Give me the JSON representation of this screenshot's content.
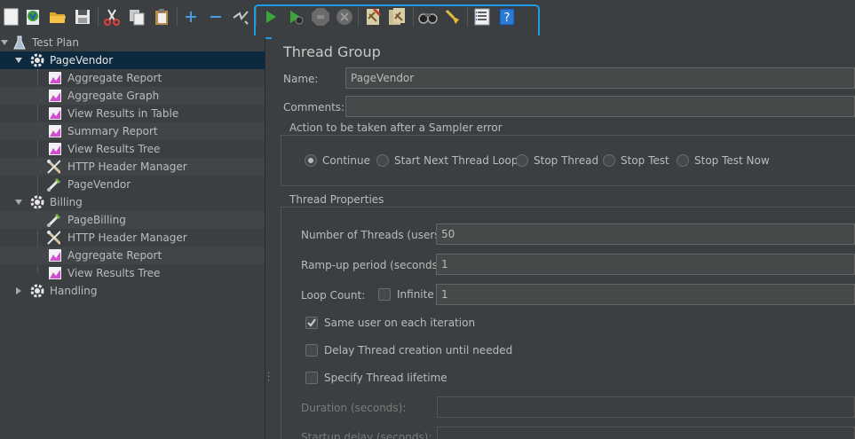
{
  "toolbar": {
    "buttons": [
      {
        "name": "new-icon"
      },
      {
        "name": "templates-icon"
      },
      {
        "name": "open-icon"
      },
      {
        "name": "save-icon"
      },
      {
        "name": "cut-icon"
      },
      {
        "name": "copy-icon"
      },
      {
        "name": "paste-icon"
      },
      {
        "name": "expand-all-icon"
      },
      {
        "name": "collapse-all-icon"
      },
      {
        "name": "toggle-icon"
      },
      {
        "name": "start-icon"
      },
      {
        "name": "start-no-pauses-icon"
      },
      {
        "name": "stop-icon"
      },
      {
        "name": "shutdown-icon"
      },
      {
        "name": "clear-icon"
      },
      {
        "name": "clear-all-icon"
      },
      {
        "name": "search-icon"
      },
      {
        "name": "reset-search-icon"
      },
      {
        "name": "function-helper-icon"
      },
      {
        "name": "help-icon"
      }
    ],
    "highlight_color": "#1e9be6"
  },
  "tree": {
    "items": [
      {
        "label": "Test Plan",
        "icon": "test-plan-icon"
      },
      {
        "label": "PageVendor",
        "icon": "thread-group-icon"
      },
      {
        "label": "Aggregate Report",
        "icon": "listener-icon"
      },
      {
        "label": "Aggregate Graph",
        "icon": "listener-icon"
      },
      {
        "label": "View Results in Table",
        "icon": "listener-icon"
      },
      {
        "label": "Summary Report",
        "icon": "listener-icon"
      },
      {
        "label": "View Results Tree",
        "icon": "listener-icon"
      },
      {
        "label": "HTTP Header Manager",
        "icon": "config-element-icon"
      },
      {
        "label": "PageVendor",
        "icon": "sampler-icon"
      },
      {
        "label": "Billing",
        "icon": "thread-group-icon"
      },
      {
        "label": "PageBilling",
        "icon": "sampler-icon"
      },
      {
        "label": "HTTP Header Manager",
        "icon": "config-element-icon"
      },
      {
        "label": "Aggregate Report",
        "icon": "listener-icon"
      },
      {
        "label": "View Results Tree",
        "icon": "listener-icon"
      },
      {
        "label": "Handling",
        "icon": "thread-group-icon"
      }
    ],
    "selected_color": "#0d293e"
  },
  "panel": {
    "title": "Thread Group",
    "name_label": "Name:",
    "name_value": "PageVendor",
    "comments_label": "Comments:",
    "comments_value": "",
    "error_section": {
      "title": "Action to be taken after a Sampler error",
      "options": [
        "Continue",
        "Start Next Thread Loop",
        "Stop Thread",
        "Stop Test",
        "Stop Test Now"
      ],
      "selected": "Continue"
    },
    "thread_props": {
      "title": "Thread Properties",
      "threads_label": "Number of Threads (users):",
      "threads_value": "50",
      "rampup_label": "Ramp-up period (seconds):",
      "rampup_value": "1",
      "loop_label": "Loop Count:",
      "infinite_label": "Infinite",
      "infinite_checked": false,
      "loop_value": "1",
      "same_user_label": "Same user on each iteration",
      "same_user_checked": true,
      "delay_label": "Delay Thread creation until needed",
      "delay_checked": false,
      "lifetime_label": "Specify Thread lifetime",
      "lifetime_checked": false,
      "duration_label": "Duration (seconds):",
      "startup_label": "Startup delay (seconds):"
    }
  }
}
